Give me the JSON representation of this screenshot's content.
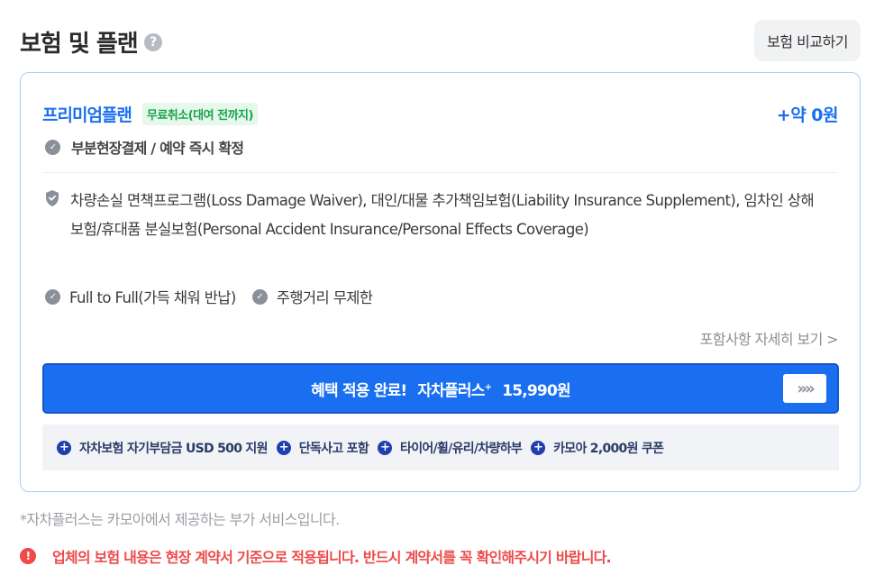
{
  "header": {
    "title": "보험 및 플랜",
    "help_icon": "question-icon",
    "compare_label": "보험 비교하기"
  },
  "plan": {
    "name": "프리미엄플랜",
    "badge": "무료취소(대여 전까지)",
    "price": "+약 0원",
    "payment": "부분현장결제 / 예약 즉시 확정",
    "coverage": "차량손실 면책프로그램(Loss Damage Waiver), 대인/대물 추가책임보험(Liability Insurance Supplement), 임차인 상해보험/휴대품 분실보험(Personal Accident Insurance/Personal Effects Coverage)",
    "features": [
      "Full to Full(가득 채워 반납)",
      "주행거리 무제한"
    ],
    "detail_link": "포함사항 자세히 보기 >"
  },
  "benefit": {
    "status": "혜택 적용 완료!",
    "service": "자차플러스",
    "service_mark": "+",
    "price": "15,990원",
    "arrow": "»"
  },
  "perks": [
    "자차보험 자기부담금 USD 500 지원",
    "단독사고 포함",
    "타이어/휠/유리/차량하부",
    "카모아 2,000원 쿠폰"
  ],
  "footer": {
    "note": "*자차플러스는 카모아에서 제공하는 부가 서비스입니다.",
    "warning": "업체의 보험 내용은 현장 계약서 기준으로 적용됩니다. 반드시 계약서를 꼭 확인해주시기 바랍니다."
  },
  "colors": {
    "accent": "#1a6ff0",
    "badge_green": "#17a34a",
    "warning_red": "#ee4a4a",
    "perk_navy": "#1f3fae"
  }
}
